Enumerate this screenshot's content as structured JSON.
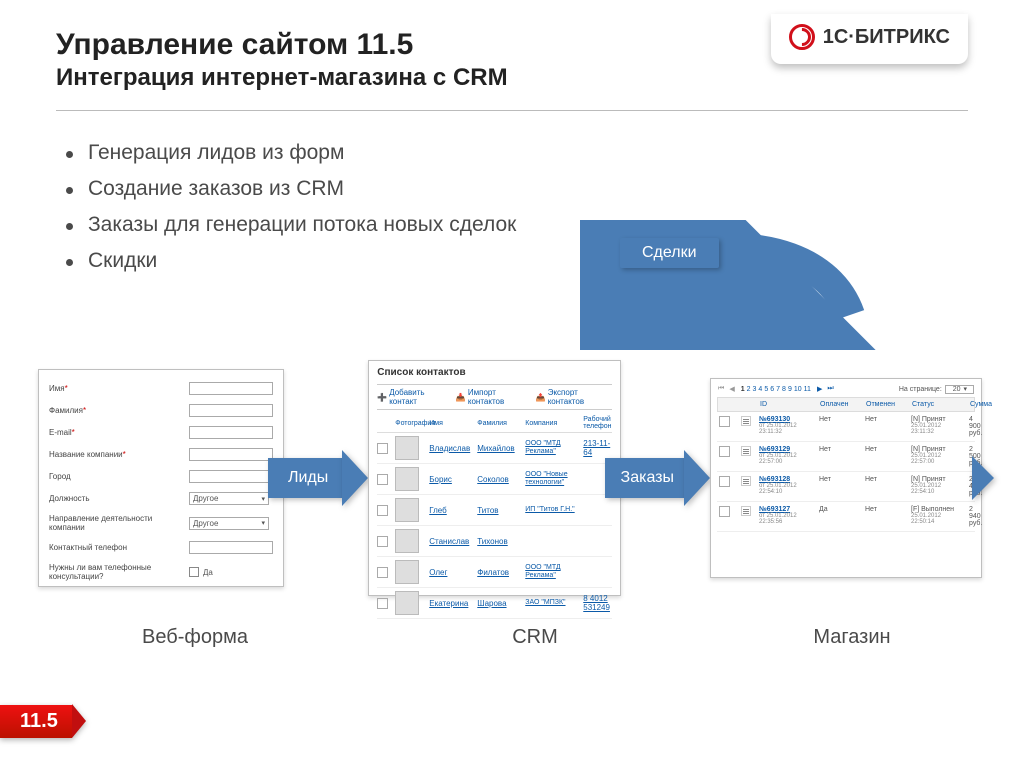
{
  "header": {
    "title": "Управление сайтом 11.5",
    "subtitle": "Интеграция интернет-магазина с CRM",
    "logo_text": "1С·БИТРИКС"
  },
  "bullets": [
    "Генерация лидов из форм",
    "Создание заказов из CRM",
    "Заказы для генерации потока новых сделок",
    "Скидки"
  ],
  "arrows": {
    "leads": "Лиды",
    "orders": "Заказы",
    "deals": "Сделки"
  },
  "captions": {
    "webform": "Веб-форма",
    "crm": "CRM",
    "store": "Магазин"
  },
  "webform": {
    "name": "Имя",
    "surname": "Фамилия",
    "email": "E-mail",
    "company": "Название компании",
    "city": "Город",
    "position": "Должность",
    "position_val": "Другое",
    "direction": "Направление деятельности компании",
    "direction_val": "Другое",
    "phone": "Контактный телефон",
    "consult": "Нужны ли вам телефонные консультации?",
    "consult_opt": "Да"
  },
  "crm": {
    "title": "Список контактов",
    "tool_add": "Добавить контакт",
    "tool_import": "Импорт контактов",
    "tool_export": "Экспорт контактов",
    "cols": {
      "photo": "Фотография",
      "name": "Имя",
      "surname": "Фамилия",
      "company": "Компания",
      "phone": "Рабочий телефон"
    },
    "rows": [
      {
        "name": "Владислав",
        "surname": "Михайлов",
        "company": "ООО \"МТД Реклама\"",
        "phone": "213-11-64"
      },
      {
        "name": "Борис",
        "surname": "Соколов",
        "company": "ООО \"Новые технологии\"",
        "phone": ""
      },
      {
        "name": "Глеб",
        "surname": "Титов",
        "company": "ИП \"Титов Г.Н.\"",
        "phone": ""
      },
      {
        "name": "Станислав",
        "surname": "Тихонов",
        "company": "",
        "phone": ""
      },
      {
        "name": "Олег",
        "surname": "Филатов",
        "company": "ООО \"МТД Реклама\"",
        "phone": ""
      },
      {
        "name": "Екатерина",
        "surname": "Шарова",
        "company": "ЗАО \"МПЗК\"",
        "phone": "8 4012 531249"
      }
    ]
  },
  "store": {
    "pages": [
      "1",
      "2",
      "3",
      "4",
      "5",
      "6",
      "7",
      "8",
      "9",
      "10",
      "11"
    ],
    "perpage_label": "На странице:",
    "perpage_value": "20",
    "cols": {
      "id": "ID",
      "paid": "Оплачен",
      "cancelled": "Отменен",
      "status": "Статус",
      "sum": "Сумма"
    },
    "rows": [
      {
        "id": "№693130",
        "ord": "от 25.01.2012 23:11:32",
        "paid": "Нет",
        "cancelled": "Нет",
        "stat": "[N] Принят",
        "stime": "25.01.2012 23:11:32",
        "sum": "4 900 руб."
      },
      {
        "id": "№693129",
        "ord": "от 25.01.2012 22:57:00",
        "paid": "Нет",
        "cancelled": "Нет",
        "stat": "[N] Принят",
        "stime": "25.01.2012 22:57:00",
        "sum": "2 500 руб."
      },
      {
        "id": "№693128",
        "ord": "от 25.01.2012 22:54:10",
        "paid": "Нет",
        "cancelled": "Нет",
        "stat": "[N] Принят",
        "stime": "25.01.2012 22:54:10",
        "sum": "2 450 руб."
      },
      {
        "id": "№693127",
        "ord": "от 25.01.2012 22:35:56",
        "paid": "Да",
        "cancelled": "Нет",
        "stat": "[F] Выполнен",
        "stime": "25.01.2012 22:50:14",
        "sum": "2 940 руб."
      }
    ]
  },
  "version": "11.5"
}
